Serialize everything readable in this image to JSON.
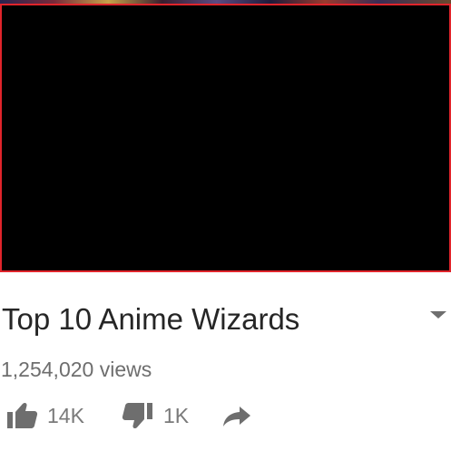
{
  "video": {
    "title": "Top 10 Anime Wizards",
    "views": "1,254,020 views"
  },
  "actions": {
    "likes": "14K",
    "dislikes": "1K"
  },
  "icons": {
    "like": "thumbs-up-icon",
    "dislike": "thumbs-down-icon",
    "share": "share-arrow-icon",
    "expand": "chevron-down-icon"
  },
  "colors": {
    "player_border": "#e0242b",
    "player_background": "#000000",
    "title_text": "#262626",
    "secondary_text": "#6e6e6e"
  }
}
